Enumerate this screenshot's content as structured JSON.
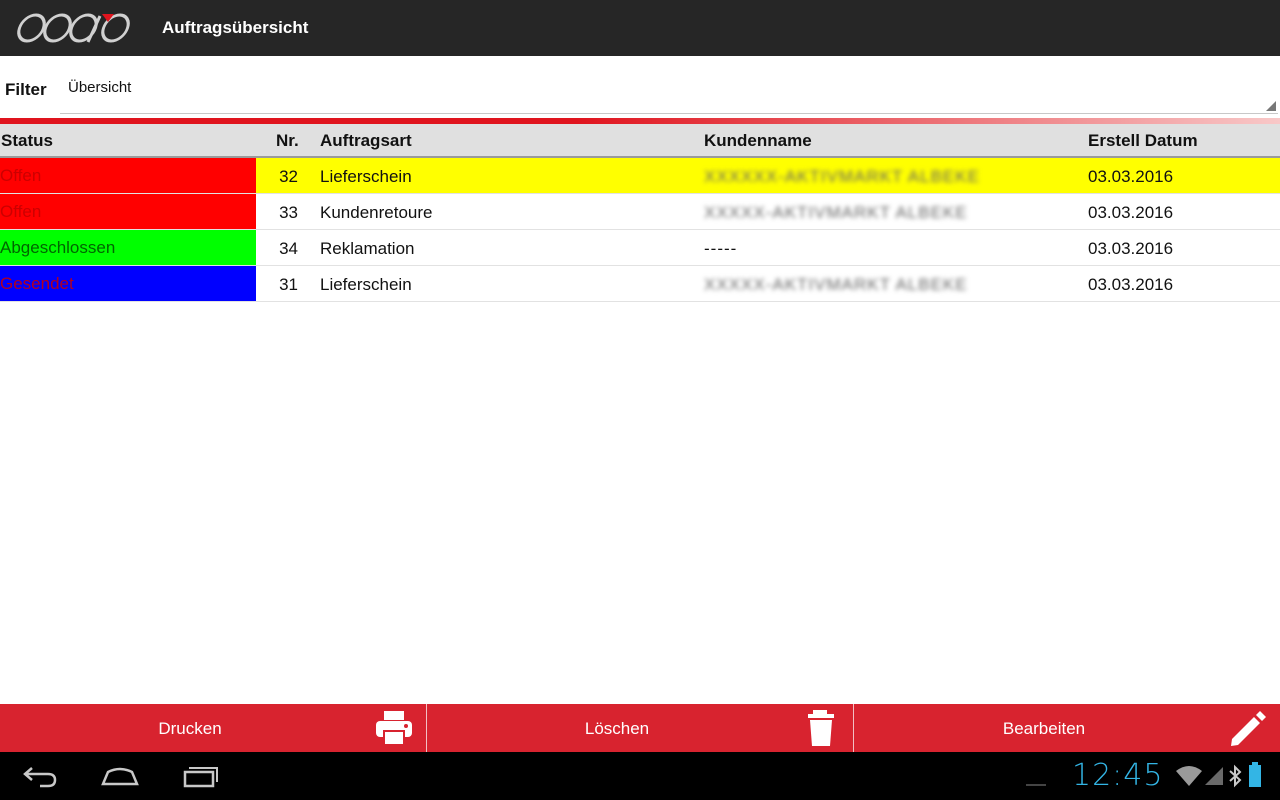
{
  "app": {
    "title": "Auftragsübersicht",
    "logo_icon": "coogo-logo"
  },
  "filter": {
    "label": "Filter",
    "value": "Übersicht"
  },
  "table": {
    "columns": [
      "Status",
      "Nr.",
      "Auftragsart",
      "Kundenname",
      "Erstell Datum"
    ],
    "rows": [
      {
        "status": "Offen",
        "status_bg": "#ff0000",
        "status_fg": "#cc0000",
        "nr": "32",
        "art": "Lieferschein",
        "kunde": "XXXXXX-AKTIVMARKT ALBEKE",
        "kunde_blurred": true,
        "datum": "03.03.2016",
        "highlight": true
      },
      {
        "status": "Offen",
        "status_bg": "#ff0000",
        "status_fg": "#cc0000",
        "nr": "33",
        "art": "Kundenretoure",
        "kunde": "XXXXX-AKTIVMARKT ALBEKE",
        "kunde_blurred": true,
        "datum": "03.03.2016",
        "highlight": false
      },
      {
        "status": "Abgeschlossen",
        "status_bg": "#00ff00",
        "status_fg": "#006600",
        "nr": "34",
        "art": "Reklamation",
        "kunde": "-----",
        "kunde_blurred": false,
        "datum": "03.03.2016",
        "highlight": false
      },
      {
        "status": "Gesendet",
        "status_bg": "#0000ff",
        "status_fg": "#b00020",
        "nr": "31",
        "art": "Lieferschein",
        "kunde": "XXXXX-AKTIVMARKT ALBEKE",
        "kunde_blurred": true,
        "datum": "03.03.2016",
        "highlight": false
      }
    ]
  },
  "actions": {
    "print_label": "Drucken",
    "print_icon": "printer-icon",
    "delete_label": "Löschen",
    "delete_icon": "trash-icon",
    "edit_label": "Bearbeiten",
    "edit_icon": "pencil-icon"
  },
  "system": {
    "clock": "12:45",
    "nav_icons": [
      "back-icon",
      "home-icon",
      "recent-apps-icon"
    ],
    "status_icons": [
      "wifi-icon",
      "signal-icon",
      "bluetooth-icon",
      "battery-icon"
    ]
  },
  "colors": {
    "accent": "#d8232f",
    "actionbar": "#262626",
    "highlight_row": "#ffff00",
    "clock": "#33b5e5"
  }
}
